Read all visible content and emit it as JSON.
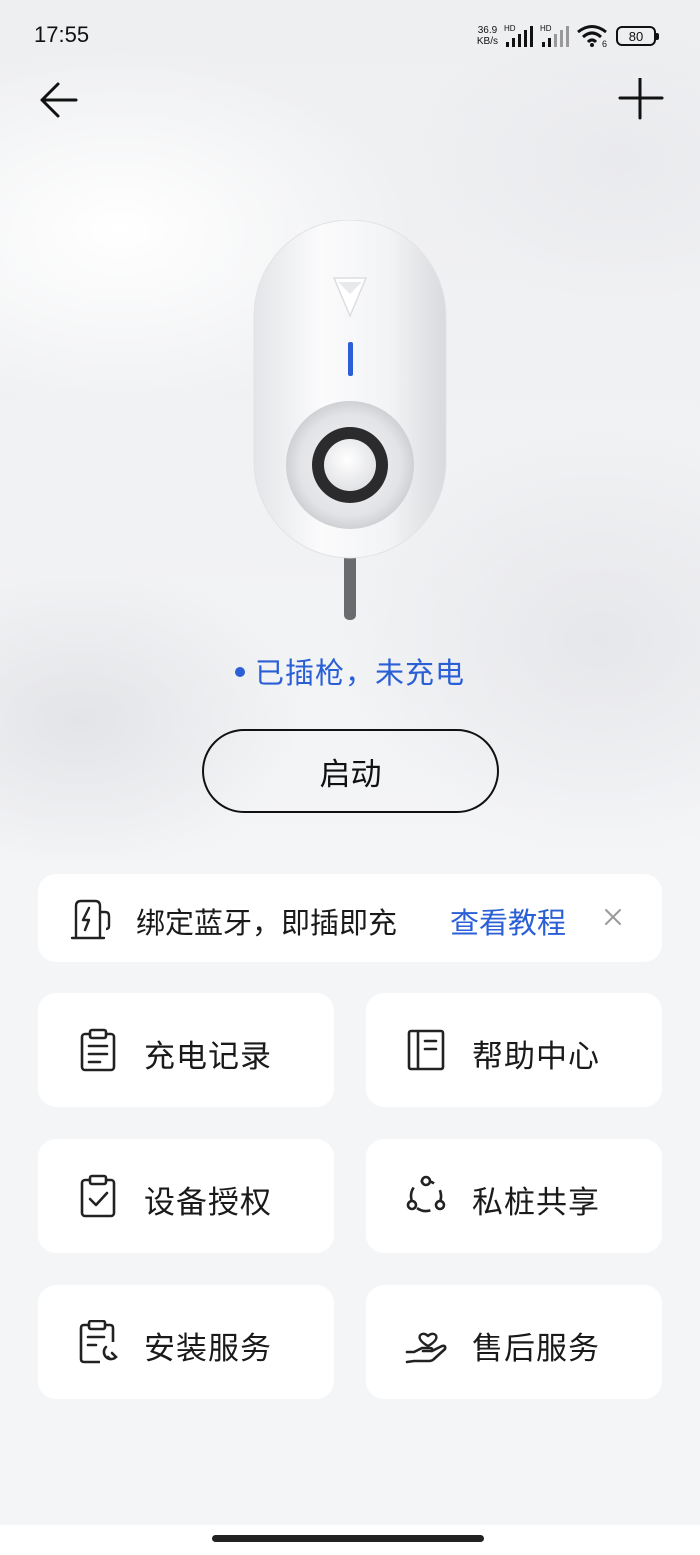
{
  "status_bar": {
    "time": "17:55",
    "net_speed_value": "36.9",
    "net_speed_unit": "KB/s",
    "signal1_label": "HD",
    "signal2_label": "HD",
    "wifi_label": "6",
    "battery": "80"
  },
  "device_status": "已插枪，未充电",
  "start_button": "启动",
  "bluetooth_banner": {
    "text": "绑定蓝牙，即插即充",
    "link": "查看教程"
  },
  "tiles": [
    {
      "label": "充电记录",
      "icon": "clipboard-list-icon"
    },
    {
      "label": "帮助中心",
      "icon": "notebook-icon"
    },
    {
      "label": "设备授权",
      "icon": "clipboard-check-icon"
    },
    {
      "label": "私桩共享",
      "icon": "share-nodes-icon"
    },
    {
      "label": "安装服务",
      "icon": "install-wrench-icon"
    },
    {
      "label": "售后服务",
      "icon": "hand-heart-icon"
    }
  ],
  "colors": {
    "accent": "#2a5fd6",
    "text": "#1a1a1a",
    "card": "#ffffff",
    "background": "#f4f5f7"
  }
}
